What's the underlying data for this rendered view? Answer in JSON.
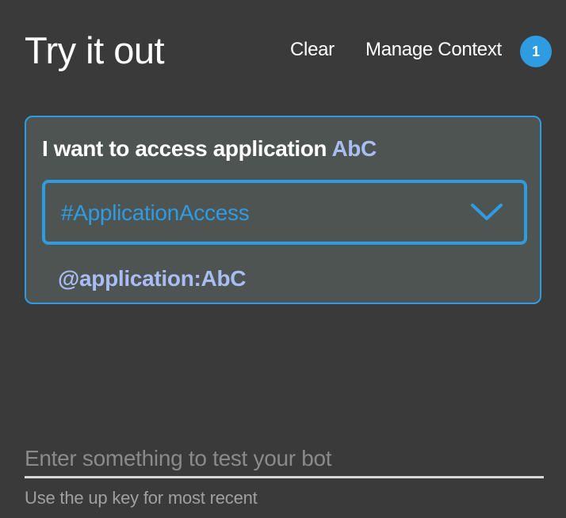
{
  "header": {
    "title": "Try it out",
    "clear_label": "Clear",
    "manage_context_label": "Manage Context",
    "context_count": "1"
  },
  "card": {
    "utterance_text": "I want to access application ",
    "utterance_entity": "AbC",
    "intent_value": "#ApplicationAccess",
    "entity_tag": "@application:AbC"
  },
  "input": {
    "placeholder": "Enter something to test your bot",
    "value": "",
    "hint": "Use the up key for most recent"
  },
  "icons": {
    "dropdown": "chevron-down-icon"
  },
  "colors": {
    "background": "#3a3a3a",
    "card_background": "#4e5452",
    "accent": "#2f9be0",
    "entity": "#a9bdf2",
    "placeholder": "#8a8a8a",
    "hint": "#a0a0a0"
  }
}
